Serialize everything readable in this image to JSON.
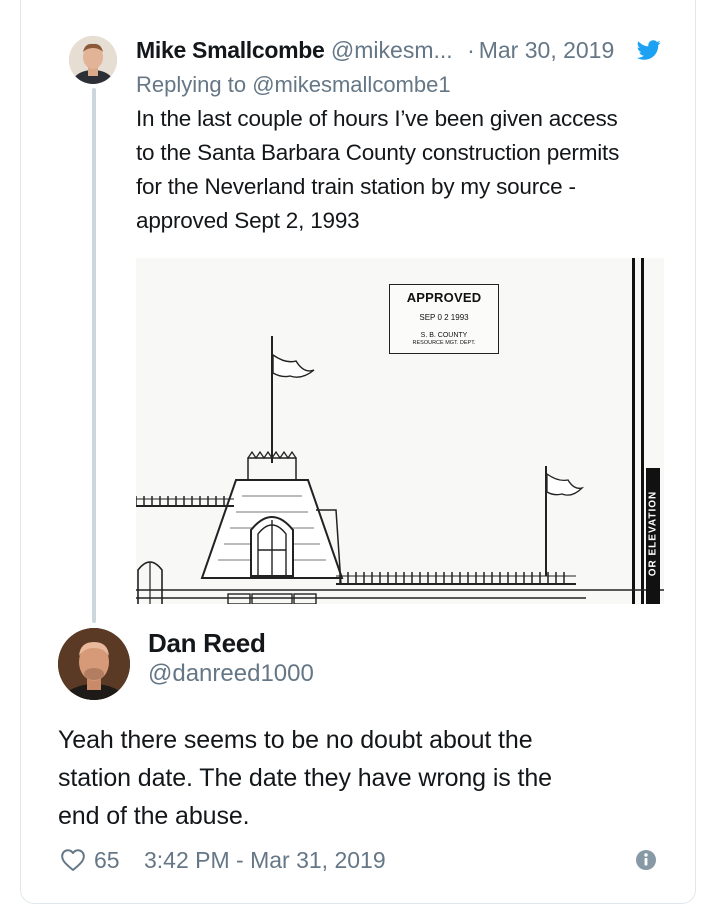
{
  "quoted_tweet": {
    "author_name": "Mike Smallcombe",
    "author_handle": "@mikesm...",
    "separator": "·",
    "date": "Mar 30, 2019",
    "replying_prefix": "Replying to",
    "replying_to": "@mikesmallcombe1",
    "body": "In the last couple of hours I’ve been given access\nto the Santa Barbara County construction permits\nfor the Neverland train station by my source -\napproved Sept 2, 1993",
    "image": {
      "stamp_title": "APPROVED",
      "stamp_date": "SEP 0 2 1993",
      "stamp_county": "S. B. COUNTY",
      "stamp_dept": "RESOURCE MGT. DEPT.",
      "side_label": "OR ELEVATION"
    },
    "brand_icon": "twitter-bird-icon",
    "brand_color": "#1da1f2"
  },
  "tweet": {
    "author_name": "Dan Reed",
    "author_handle": "@danreed1000",
    "body": "Yeah there seems to be no doubt about the\nstation date. The date they have wrong is the\nend of the abuse.",
    "like_count": "65",
    "timestamp": "3:42 PM - Mar 31, 2019",
    "like_icon": "heart-icon",
    "info_icon": "info-icon"
  }
}
